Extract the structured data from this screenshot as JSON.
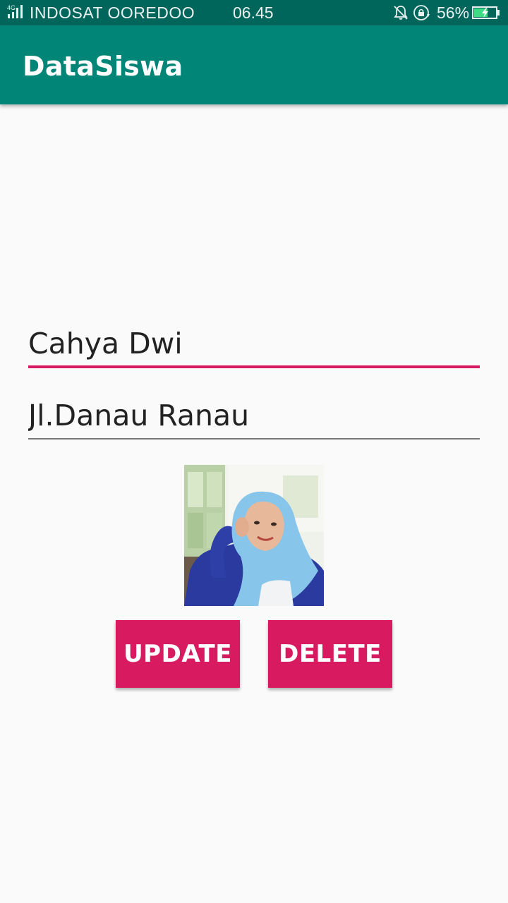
{
  "status_bar": {
    "network_type": "4G",
    "carrier": "INDOSAT OOREDOO",
    "time": "06.45",
    "battery_percent": "56%",
    "icons": [
      "signal-icon",
      "alarm-off-icon",
      "rotation-lock-icon",
      "battery-charging-icon"
    ]
  },
  "app_bar": {
    "title": "DataSiswa",
    "color": "#008577"
  },
  "form": {
    "name_value": "Cahya Dwi",
    "address_value": "Jl.Danau Ranau"
  },
  "photo": {
    "icon": "student-photo"
  },
  "actions": {
    "update_label": "UPDATE",
    "delete_label": "DELETE"
  },
  "colors": {
    "status_bar": "#00665c",
    "accent": "#d81b60",
    "background": "#fafafa"
  }
}
